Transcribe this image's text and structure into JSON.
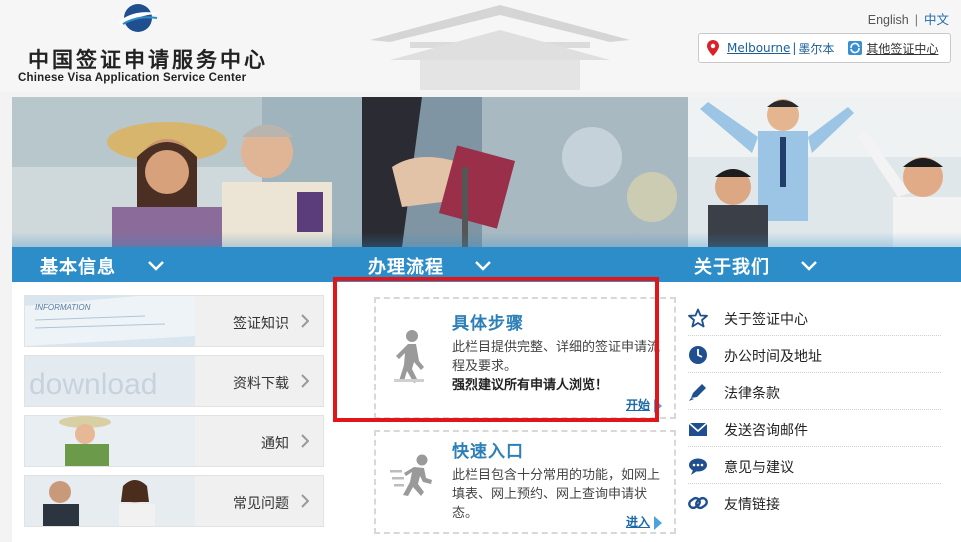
{
  "header": {
    "logo_cn": "中国签证申请服务中心",
    "logo_en": "Chinese Visa Application Service Center",
    "lang_en": "English",
    "lang_sep": "|",
    "lang_cn": "中文",
    "city": "Melbourne",
    "city_sep": "|",
    "city_cn": "墨尔本",
    "other_centers": "其他签证中心"
  },
  "columns": {
    "basic": {
      "title": "基本信息",
      "items": [
        {
          "label": "签证知识",
          "thumb_text": "INFORMATION"
        },
        {
          "label": "资料下载",
          "thumb_text": "download"
        },
        {
          "label": "通知"
        },
        {
          "label": "常见问题"
        }
      ]
    },
    "process": {
      "title": "办理流程",
      "steps": {
        "title": "具体步骤",
        "desc": "此栏目提供完整、详细的签证申请流程及要求。",
        "strong": "强烈建议所有申请人浏览！",
        "link": "开始"
      },
      "quick": {
        "title": "快速入口",
        "desc": "此栏目包含十分常用的功能，如网上填表、网上预约、网上查询申请状态。",
        "link": "进入"
      }
    },
    "about": {
      "title": "关于我们",
      "items": [
        {
          "label": "关于签证中心",
          "icon": "star-icon"
        },
        {
          "label": "办公时间及地址",
          "icon": "clock-icon"
        },
        {
          "label": "法律条款",
          "icon": "pen-icon"
        },
        {
          "label": "发送咨询邮件",
          "icon": "mail-icon"
        },
        {
          "label": "意见与建议",
          "icon": "chat-icon"
        },
        {
          "label": "友情链接",
          "icon": "link-icon"
        }
      ]
    }
  },
  "colors": {
    "band": "#2d8dc9",
    "link": "#1a6aa8",
    "highlight": "#e0161b"
  }
}
